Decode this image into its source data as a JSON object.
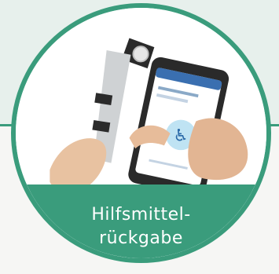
{
  "theme": {
    "accent": "#3a9c7c",
    "background_top": "#e7f0ec",
    "background_bottom": "#f6f6f4",
    "label_text": "#ffffff"
  },
  "badge": {
    "label_line1": "Hilfsmittel-",
    "label_line2": "rückgabe",
    "photo_subject": "hand-holding-smartphone-with-app-next-to-walker-handle"
  },
  "phone_app": {
    "icon": "wheelchair-icon"
  }
}
